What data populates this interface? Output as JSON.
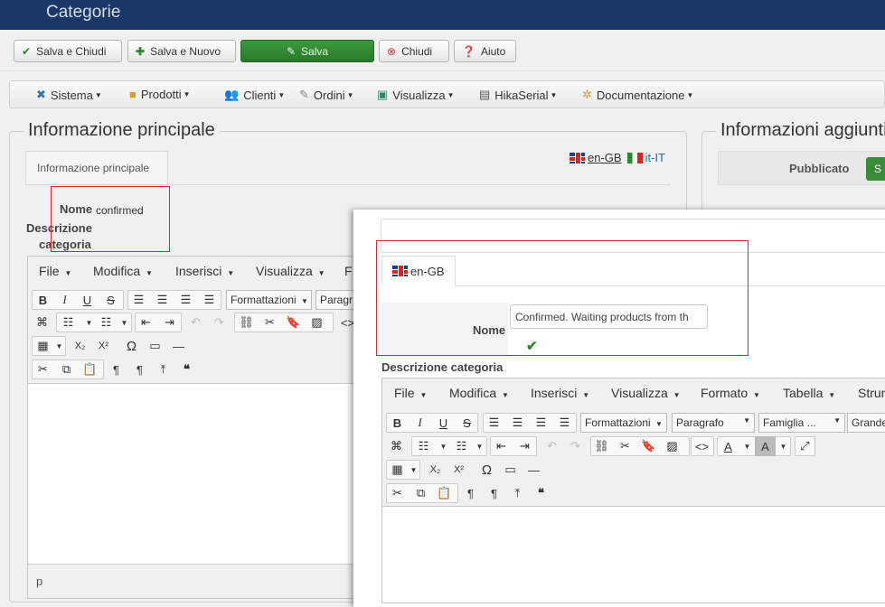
{
  "header": {
    "title": "Categorie"
  },
  "actions": [
    {
      "label": "Salva e Chiudi",
      "icon": "check-icon"
    },
    {
      "label": "Salva e Nuovo",
      "icon": "plus-icon"
    },
    {
      "label": "Salva",
      "icon": "edit-icon"
    },
    {
      "label": "Chiudi",
      "icon": "close-circle-icon"
    },
    {
      "label": "Aiuto",
      "icon": "question-icon"
    }
  ],
  "menubar": [
    {
      "label": "Sistema",
      "icon": "wrench-icon"
    },
    {
      "label": "Prodotti",
      "icon": "box-icon"
    },
    {
      "label": "Clienti",
      "icon": "users-icon"
    },
    {
      "label": "Ordini",
      "icon": "orders-icon"
    },
    {
      "label": "Visualizza",
      "icon": "display-icon"
    },
    {
      "label": "HikaSerial",
      "icon": "serial-icon"
    },
    {
      "label": "Documentazione",
      "icon": "docs-icon"
    }
  ],
  "main": {
    "legend": "Informazione principale",
    "tab": "Informazione principale",
    "languages": [
      "en-GB",
      "it-IT"
    ],
    "name_label": "Nome",
    "name_value": "confirmed",
    "desc_label_1": "Descrizione",
    "desc_label_2": "categoria",
    "editor": {
      "menus": [
        "File",
        "Modifica",
        "Inserisci",
        "Visualizza",
        "F"
      ],
      "format_select": "Formattazioni",
      "para_select": "Paragr",
      "status": "p"
    }
  },
  "side": {
    "legend": "Informazioni aggiuntive",
    "published_label": "Pubblicato",
    "published_btn": "S"
  },
  "dialog": {
    "tab": "en-GB",
    "name_label": "Nome",
    "name_value": "Confirmed. Waiting products from th",
    "desc_label": "Descrizione categoria",
    "editor": {
      "menus": [
        "File",
        "Modifica",
        "Inserisci",
        "Visualizza",
        "Formato",
        "Tabella",
        "Strum"
      ],
      "format_select": "Formattazioni",
      "para_select": "Paragrafo",
      "font_select": "Famiglia ...",
      "size_select": "Grande"
    }
  },
  "colors": {
    "header": "#1a3867",
    "save": "#2e8b2e",
    "highlight": "#d42a2a"
  }
}
